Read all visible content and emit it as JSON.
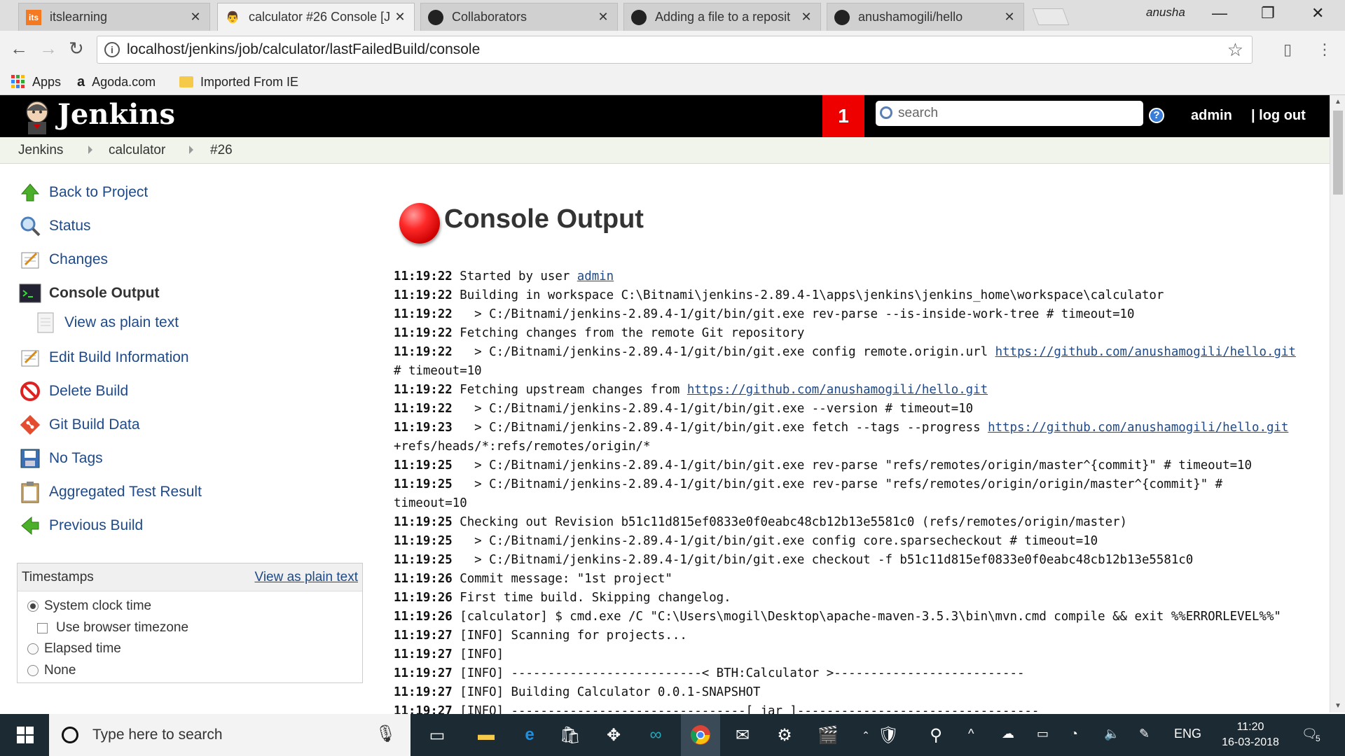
{
  "browser": {
    "tabs": [
      {
        "title": "itslearning",
        "icon": "its-icon"
      },
      {
        "title": "calculator #26 Console [J",
        "icon": "jenkins-icon"
      },
      {
        "title": "Collaborators",
        "icon": "github-icon"
      },
      {
        "title": "Adding a file to a reposit",
        "icon": "github-icon"
      },
      {
        "title": "anushamogili/hello",
        "icon": "github-icon"
      }
    ],
    "profile_name": "anusha",
    "url": "localhost/jenkins/job/calculator/lastFailedBuild/console",
    "bookmarks": [
      {
        "label": "Apps"
      },
      {
        "label": "Agoda.com"
      },
      {
        "label": "Imported From IE"
      }
    ]
  },
  "jenkins": {
    "title": "Jenkins",
    "notification_count": "1",
    "search_placeholder": "search",
    "help": "?",
    "user": "admin",
    "logout": "| log out",
    "breadcrumb": [
      "Jenkins",
      "calculator",
      "#26"
    ]
  },
  "sidebar": {
    "items": [
      {
        "label": "Back to Project"
      },
      {
        "label": "Status"
      },
      {
        "label": "Changes"
      },
      {
        "label": "Console Output"
      },
      {
        "label": "View as plain text"
      },
      {
        "label": "Edit Build Information"
      },
      {
        "label": "Delete Build"
      },
      {
        "label": "Git Build Data"
      },
      {
        "label": "No Tags"
      },
      {
        "label": "Aggregated Test Result"
      },
      {
        "label": "Previous Build"
      }
    ],
    "timestamps": {
      "title": "Timestamps",
      "plain_link": "View as plain text",
      "options": [
        "System clock time",
        "Use browser timezone",
        "Elapsed time",
        "None"
      ],
      "selected": "System clock time"
    }
  },
  "main": {
    "title": "Console Output",
    "lines": [
      {
        "t": "11:19:22",
        "text": "Started by user ",
        "link": "admin"
      },
      {
        "t": "11:19:22",
        "text": "Building in workspace C:\\Bitnami\\jenkins-2.89.4-1\\apps\\jenkins\\jenkins_home\\workspace\\calculator"
      },
      {
        "t": "11:19:22",
        "text": "  > C:/Bitnami/jenkins-2.89.4-1/git/bin/git.exe rev-parse --is-inside-work-tree # timeout=10"
      },
      {
        "t": "11:19:22",
        "text": "Fetching changes from the remote Git repository"
      },
      {
        "t": "11:19:22",
        "text": "  > C:/Bitnami/jenkins-2.89.4-1/git/bin/git.exe config remote.origin.url ",
        "link": "https://github.com/anushamogili/hello.git"
      },
      {
        "t": "",
        "text": "# timeout=10"
      },
      {
        "t": "11:19:22",
        "text": "Fetching upstream changes from ",
        "link": "https://github.com/anushamogili/hello.git"
      },
      {
        "t": "11:19:22",
        "text": "  > C:/Bitnami/jenkins-2.89.4-1/git/bin/git.exe --version # timeout=10"
      },
      {
        "t": "11:19:23",
        "text": "  > C:/Bitnami/jenkins-2.89.4-1/git/bin/git.exe fetch --tags --progress ",
        "link": "https://github.com/anushamogili/hello.git"
      },
      {
        "t": "",
        "text": "+refs/heads/*:refs/remotes/origin/*"
      },
      {
        "t": "11:19:25",
        "text": "  > C:/Bitnami/jenkins-2.89.4-1/git/bin/git.exe rev-parse \"refs/remotes/origin/master^{commit}\" # timeout=10"
      },
      {
        "t": "11:19:25",
        "text": "  > C:/Bitnami/jenkins-2.89.4-1/git/bin/git.exe rev-parse \"refs/remotes/origin/origin/master^{commit}\" #"
      },
      {
        "t": "",
        "text": "timeout=10"
      },
      {
        "t": "11:19:25",
        "text": "Checking out Revision b51c11d815ef0833e0f0eabc48cb12b13e5581c0 (refs/remotes/origin/master)"
      },
      {
        "t": "11:19:25",
        "text": "  > C:/Bitnami/jenkins-2.89.4-1/git/bin/git.exe config core.sparsecheckout # timeout=10"
      },
      {
        "t": "11:19:25",
        "text": "  > C:/Bitnami/jenkins-2.89.4-1/git/bin/git.exe checkout -f b51c11d815ef0833e0f0eabc48cb12b13e5581c0"
      },
      {
        "t": "11:19:26",
        "text": "Commit message: \"1st project\""
      },
      {
        "t": "11:19:26",
        "text": "First time build. Skipping changelog."
      },
      {
        "t": "11:19:26",
        "text": "[calculator] $ cmd.exe /C \"C:\\Users\\mogil\\Desktop\\apache-maven-3.5.3\\bin\\mvn.cmd compile && exit %%ERRORLEVEL%%\""
      },
      {
        "t": "11:19:27",
        "text": "[INFO] Scanning for projects..."
      },
      {
        "t": "11:19:27",
        "text": "[INFO]"
      },
      {
        "t": "11:19:27",
        "text": "[INFO] --------------------------< BTH:Calculator >--------------------------"
      },
      {
        "t": "11:19:27",
        "text": "[INFO] Building Calculator 0.0.1-SNAPSHOT"
      },
      {
        "t": "11:19:27",
        "text": "[INFO] --------------------------------[ jar ]---------------------------------"
      }
    ]
  },
  "taskbar": {
    "search_placeholder": "Type here to search",
    "language": "ENG",
    "time": "11:20",
    "date": "16-03-2018",
    "notification_count": "5"
  }
}
